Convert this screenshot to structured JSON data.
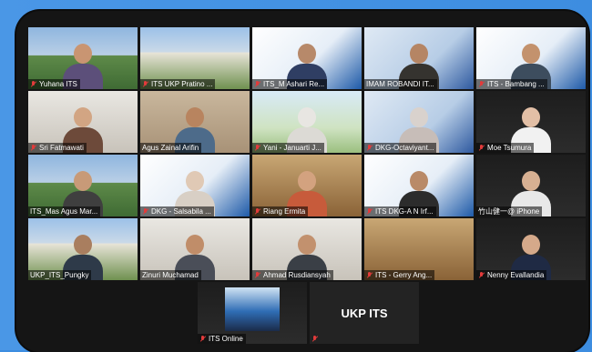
{
  "meeting": {
    "title_tile": "UKP ITS",
    "participants": [
      {
        "name": "Yuhana ITS",
        "muted": true
      },
      {
        "name": "ITS UKP Pratino ...",
        "muted": true
      },
      {
        "name": "ITS_M Ashari Re...",
        "muted": true
      },
      {
        "name": "IMAM ROBANDI IT...",
        "muted": false
      },
      {
        "name": "ITS - Bambang ...",
        "muted": true
      },
      {
        "name": "Sri Fatmawati",
        "muted": true
      },
      {
        "name": "Agus Zainal Arifin",
        "muted": false
      },
      {
        "name": "Yani - Januarti J...",
        "muted": true
      },
      {
        "name": "DKG-Octaviyant...",
        "muted": true
      },
      {
        "name": "Moe Tsumura",
        "muted": true
      },
      {
        "name": "ITS_Mas Agus Mar...",
        "muted": false
      },
      {
        "name": "DKG - Salsabila ...",
        "muted": true
      },
      {
        "name": "Riang Ermita",
        "muted": true
      },
      {
        "name": "ITS DKG-A N Irf...",
        "muted": true
      },
      {
        "name": "竹山健一@ iPhone",
        "muted": false
      },
      {
        "name": "UKP_ITS_Pungky",
        "muted": false
      },
      {
        "name": "Zinuri Muchamad",
        "muted": false
      },
      {
        "name": "Ahmad Rusdiansyah",
        "muted": true
      },
      {
        "name": "ITS - Gerry Ang...",
        "muted": true
      },
      {
        "name": "Nenny Evallandia",
        "muted": true
      },
      {
        "name": "ITS Online",
        "muted": true
      },
      {
        "name": "",
        "muted": true
      }
    ]
  },
  "colors": {
    "background": "#3d8de0",
    "window": "#151515",
    "active_speaker": "#d9e23a",
    "muted_icon": "#e23b3b"
  }
}
